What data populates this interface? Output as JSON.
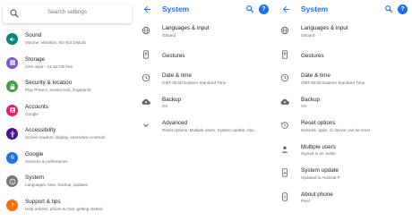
{
  "colors": {
    "accent": "#1a73e8",
    "sound": "#00897b",
    "storage": "#7e57c2",
    "security": "#43a047",
    "accounts": "#e91e63",
    "accessibility": "#4a148c",
    "google": "#1a73e8",
    "system": "#757575",
    "support": "#ff6f00"
  },
  "settings_home": {
    "search_placeholder": "Search settings",
    "items": [
      {
        "title": "Sound",
        "subtitle": "Volume, vibration, Do Not Disturb",
        "icon": "volume-icon"
      },
      {
        "title": "Storage",
        "subtitle": "24% used - 24.16 GB free",
        "icon": "storage-icon"
      },
      {
        "title": "Security & location",
        "subtitle": "Play Protect, screen lock, fingerprint",
        "icon": "lock-icon"
      },
      {
        "title": "Accounts",
        "subtitle": "Google",
        "icon": "account-icon"
      },
      {
        "title": "Accessibility",
        "subtitle": "Screen readers, display, interaction controls",
        "icon": "accessibility-icon"
      },
      {
        "title": "Google",
        "subtitle": "Services & preferences",
        "icon": "google-icon"
      },
      {
        "title": "System",
        "subtitle": "Languages, time, backup, updates",
        "icon": "info-icon"
      },
      {
        "title": "Support & tips",
        "subtitle": "Help articles, phone & chat, getting started",
        "icon": "help-icon"
      }
    ]
  },
  "system_collapsed": {
    "title": "System",
    "help_label": "?",
    "items": [
      {
        "title": "Languages & input",
        "subtitle": "Gboard",
        "icon": "globe-icon"
      },
      {
        "title": "Gestures",
        "subtitle": "",
        "icon": "gesture-icon"
      },
      {
        "title": "Date & time",
        "subtitle": "GMT-05:00 Eastern Standard Time",
        "icon": "clock-icon"
      },
      {
        "title": "Backup",
        "subtitle": "On",
        "icon": "cloud-upload-icon"
      },
      {
        "title": "Advanced",
        "subtitle": "Reset options, Multiple users, System update, Abo...",
        "icon": "chevron-down-icon"
      }
    ]
  },
  "system_expanded": {
    "title": "System",
    "help_label": "?",
    "items": [
      {
        "title": "Languages & input",
        "subtitle": "Gboard",
        "icon": "globe-icon"
      },
      {
        "title": "Gestures",
        "subtitle": "",
        "icon": "gesture-icon"
      },
      {
        "title": "Date & time",
        "subtitle": "GMT-05:00 Eastern Standard Time",
        "icon": "clock-icon"
      },
      {
        "title": "Backup",
        "subtitle": "On",
        "icon": "cloud-upload-icon"
      },
      {
        "title": "Reset options",
        "subtitle": "Network, apps, or device can be reset",
        "icon": "history-icon"
      },
      {
        "title": "Multiple users",
        "subtitle": "Signed in as Justin",
        "icon": "person-icon"
      },
      {
        "title": "System update",
        "subtitle": "Updated to Android P",
        "icon": "phone-update-icon"
      },
      {
        "title": "About phone",
        "subtitle": "Pixel",
        "icon": "phone-info-icon"
      }
    ]
  }
}
